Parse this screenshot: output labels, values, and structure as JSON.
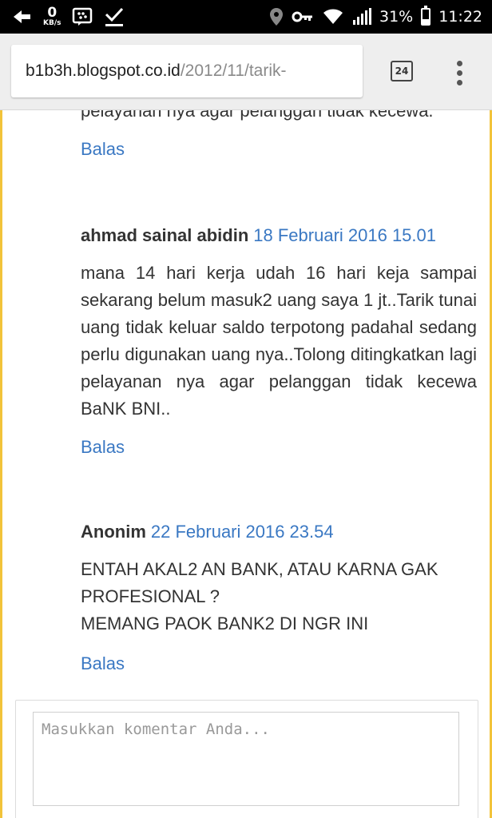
{
  "status_bar": {
    "net_speed_value": "0",
    "net_speed_unit": "KB/s",
    "battery_percent": "31%",
    "battery_level": 0.31,
    "time": "11:22"
  },
  "browser": {
    "url_host": "b1b3h.blogspot.co.id",
    "url_path": "/2012/11/tarik-",
    "tab_count": "24"
  },
  "comments": {
    "partial_text": "pelayanan nya agar pelanggan tidak kecewa.",
    "reply_label": "Balas",
    "items": [
      {
        "author": "ahmad sainal abidin",
        "date": "18 Februari 2016 15.01",
        "text": "mana 14 hari kerja udah 16 hari keja sampai sekarang belum masuk2 uang saya 1 jt..Tarik tunai uang tidak keluar saldo terpotong padahal sedang perlu digunakan uang nya..Tolong ditingkatkan lagi pelayanan nya agar pelanggan tidak kecewa BaNK BNI.."
      },
      {
        "author": "Anonim",
        "date": "22 Februari 2016 23.54",
        "line1": "ENTAH AKAL2 AN BANK, ATAU KARNA GAK PROFESIONAL ?",
        "line2": "MEMANG PAOK BANK2 DI NGR INI"
      }
    ]
  },
  "comment_form": {
    "placeholder": "Masukkan komentar Anda..."
  }
}
